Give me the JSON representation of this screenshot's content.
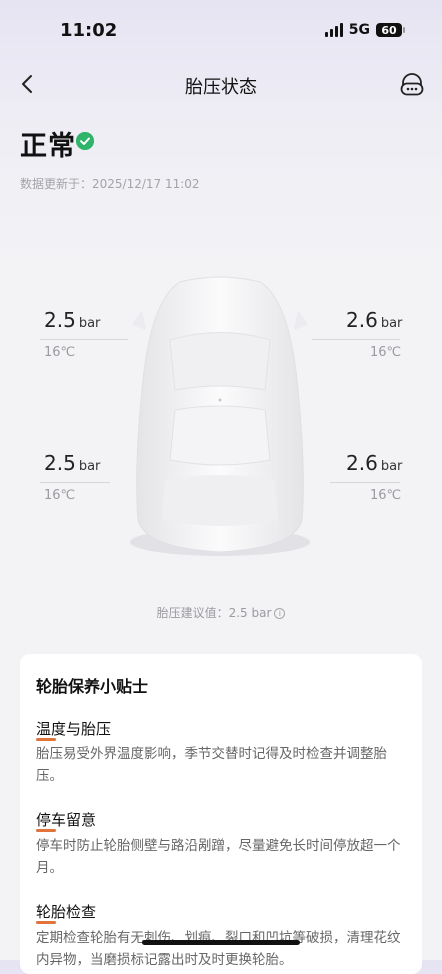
{
  "status_bar": {
    "time": "11:02",
    "network": "5G",
    "battery": "60"
  },
  "nav": {
    "title": "胎压状态"
  },
  "status": {
    "label": "正常",
    "updated": "数据更新于：2025/12/17 11:02"
  },
  "tyres": {
    "front_left": {
      "pressure": "2.5",
      "unit": "bar",
      "temp": "16℃"
    },
    "front_right": {
      "pressure": "2.6",
      "unit": "bar",
      "temp": "16℃"
    },
    "rear_left": {
      "pressure": "2.5",
      "unit": "bar",
      "temp": "16℃"
    },
    "rear_right": {
      "pressure": "2.6",
      "unit": "bar",
      "temp": "16℃"
    }
  },
  "advice": {
    "text": "胎压建议值：2.5 bar",
    "info_icon": "i"
  },
  "tips": {
    "title": "轮胎保养小贴士",
    "items": [
      {
        "heading": "温度与胎压",
        "body": "胎压易受外界温度影响，季节交替时记得及时检查并调整胎压。"
      },
      {
        "heading": "停车留意",
        "body": "停车时防止轮胎侧壁与路沿剐蹭，尽量避免长时间停放超一个月。"
      },
      {
        "heading": "轮胎检查",
        "body": "定期检查轮胎有无刺伤、划痕、裂口和凹坑等破损，清理花纹内异物，当磨损标记露出时及时更换轮胎。"
      }
    ]
  },
  "icons": {
    "back": "chevron-left-icon",
    "service": "customer-service-icon",
    "check": "check-circle-icon"
  },
  "colors": {
    "ok_green": "#2fb46a",
    "accent_orange": "#e0743a"
  }
}
